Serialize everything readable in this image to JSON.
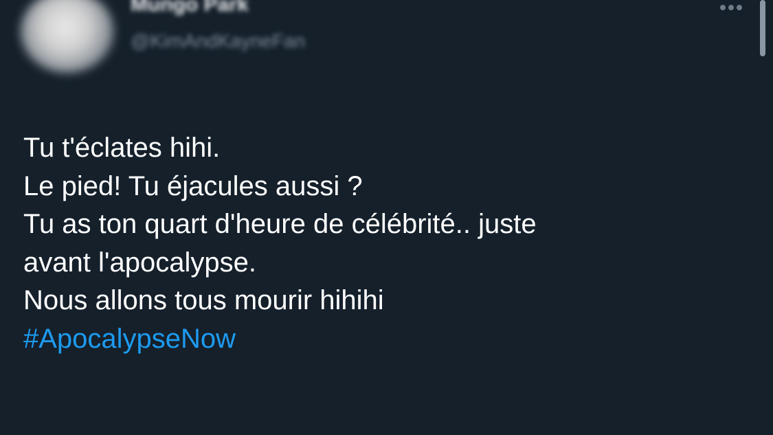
{
  "author": {
    "display_name": "Mungo Park",
    "handle": "@KimAndKayneFan"
  },
  "menu": {
    "more_icon": "more-horizontal-icon"
  },
  "tweet": {
    "lines": [
      "Tu t'éclates hihi.",
      "Le pied! Tu éjacules aussi ?",
      "Tu as ton quart d'heure de célébrité.. juste",
      "avant l'apocalypse.",
      "Nous allons tous mourir hihihi"
    ],
    "hashtag": "#ApocalypseNow"
  },
  "colors": {
    "background": "#15202b",
    "text": "#ffffff",
    "link": "#1d9bf0",
    "muted": "#7d8b98"
  }
}
